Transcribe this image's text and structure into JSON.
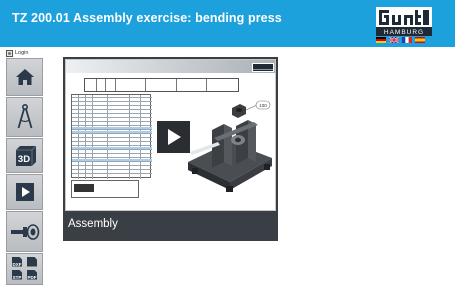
{
  "header": {
    "title": "TZ 200.01 Assembly exercise: bending press",
    "brand_logo": "gunt HAMBURG",
    "background": "#1da1dd",
    "languages": [
      "de",
      "en",
      "fr",
      "es"
    ]
  },
  "sidebar": {
    "login_label": "Login",
    "buttons": [
      {
        "name": "home",
        "icon": "house-icon"
      },
      {
        "name": "technical-drawing",
        "icon": "compass-icon"
      },
      {
        "name": "3d-view",
        "icon": "cube-3d-icon",
        "label": "3D"
      },
      {
        "name": "video",
        "icon": "play-icon"
      },
      {
        "name": "parts",
        "icon": "bolt-part-icon"
      },
      {
        "name": "cad-downloads",
        "icon": "cad-files-icon",
        "labels": [
          "DXF",
          "",
          "STP",
          "PDF"
        ]
      }
    ]
  },
  "main": {
    "card": {
      "label": "Assembly",
      "balloon_number": "100",
      "background": "#3a3f45"
    }
  }
}
